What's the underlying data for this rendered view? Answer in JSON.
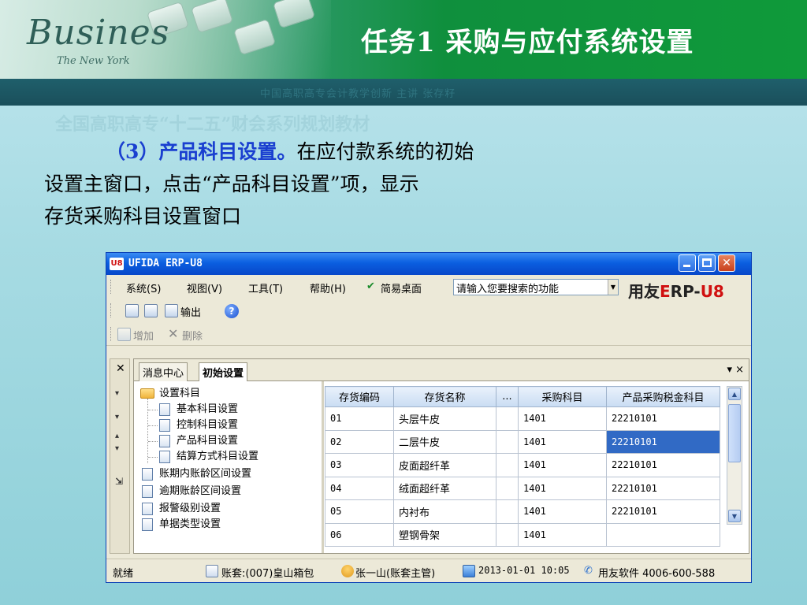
{
  "slide": {
    "banner_word": "Busines",
    "banner_sub": "The New York",
    "title": "任务1   采购与应付系统设置",
    "strip_text": "中国高职高专会计教学创新   主讲   张存籽",
    "ghost_text": "全国高职高专“十二五”财会系列规划教材",
    "body": {
      "highlight": "（3）产品科目设置。",
      "line1": "在应付款系统的初始",
      "line2": "设置主窗口，点击“产品科目设置”项，显示",
      "line3": "存货采购科目设置窗口"
    }
  },
  "window": {
    "title": "UFIDA ERP-U8",
    "logo": "U8",
    "menu": [
      "系统(S)",
      "视图(V)",
      "工具(T)",
      "帮助(H)"
    ],
    "simple_desktop": "简易桌面",
    "search_placeholder": "请输入您要搜索的功能",
    "brand": {
      "a": "用友",
      "e": "E",
      "rp": "RP-",
      "u8": "U8"
    },
    "toolbar1": {
      "output": "输出"
    },
    "toolbar2": {
      "add": "增加",
      "delete": "删除"
    },
    "tabs": [
      "消息中心",
      "初始设置"
    ],
    "tabs_ctrl": "▾ ×",
    "tree": {
      "root": "设置科目",
      "children": [
        "基本科目设置",
        "控制科目设置",
        "产品科目设置",
        "结算方式科目设置"
      ],
      "others": [
        "账期内账龄区间设置",
        "逾期账龄区间设置",
        "报警级别设置",
        "单据类型设置"
      ]
    },
    "grid": {
      "headers": [
        "存货编码",
        "存货名称",
        "...",
        "采购科目",
        "产品采购税金科目"
      ],
      "rows": [
        [
          "01",
          "头层牛皮",
          "",
          "1401",
          "22210101"
        ],
        [
          "02",
          "二层牛皮",
          "",
          "1401",
          "22210101"
        ],
        [
          "03",
          "皮面超纤革",
          "",
          "1401",
          "22210101"
        ],
        [
          "04",
          "绒面超纤革",
          "",
          "1401",
          "22210101"
        ],
        [
          "05",
          "内衬布",
          "",
          "1401",
          "22210101"
        ],
        [
          "06",
          "塑钢骨架",
          "",
          "1401",
          ""
        ]
      ]
    },
    "status": {
      "ready": "就绪",
      "account": "账套:(007)皇山箱包",
      "user": "张一山(账套主管)",
      "datetime": "2013-01-01 10:05",
      "vendor": "用友软件 4006-600-588"
    }
  }
}
